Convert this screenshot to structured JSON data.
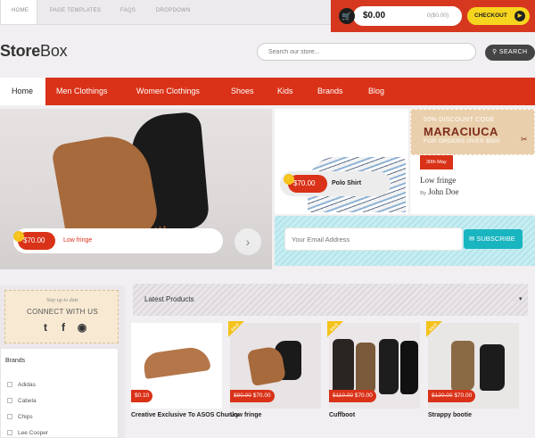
{
  "topbar": {
    "links": [
      "HOME",
      "PAGE TEMPLATES",
      "FAQS",
      "DROPDOWN"
    ],
    "cart_total": "$0.00",
    "cart_subtotal": "0($0.00)",
    "checkout_label": "CHECKOUT"
  },
  "header": {
    "logo_bold": "Store",
    "logo_light": "Box",
    "search_placeholder": "Search our store...",
    "search_button": "SEARCH"
  },
  "nav": {
    "items": [
      "Home",
      "Men Clothings",
      "Women Clothings",
      "Shoes",
      "Kids",
      "Brands",
      "Blog"
    ]
  },
  "hero": {
    "price": "$70.00",
    "name": "Low fringe",
    "next_arrow": "›"
  },
  "polo": {
    "price": "$70.00",
    "name": "Polo Shirt"
  },
  "discount": {
    "line1": "50% DISCOUNT CODE",
    "code": "MARACIUCA",
    "line3": "FOR ORDERS OVER $500"
  },
  "blog": {
    "date": "30th May",
    "title": "Low fringe",
    "by": "By",
    "author": "John Doe"
  },
  "newsletter": {
    "placeholder": "Your Email Address",
    "button": "SUBSCRIBE"
  },
  "sidebar": {
    "stay": "Stay up to date",
    "connect": "CONNECT WITH US",
    "brands_title": "Brands",
    "brands": [
      "Adidas",
      "Cabela",
      "Chips",
      "Lee Cooper"
    ]
  },
  "latest": {
    "title": "Latest Products",
    "sale_label": "SALE",
    "products": [
      {
        "name": "Creative Exclusive To ASOS Chunky",
        "old_price": "",
        "price": "$0.10"
      },
      {
        "name": "Low fringe",
        "old_price": "$90.00",
        "price": "$70.00"
      },
      {
        "name": "Cuffboot",
        "old_price": "$110.00",
        "price": "$70.00"
      },
      {
        "name": "Strappy bootie",
        "old_price": "$120.00",
        "price": "$70.00"
      }
    ]
  },
  "colors": {
    "accent_red": "#d93218",
    "checkout_yellow": "#f7d51e",
    "subscribe_teal": "#19b5c0",
    "discount_bg": "#e9cfac"
  }
}
